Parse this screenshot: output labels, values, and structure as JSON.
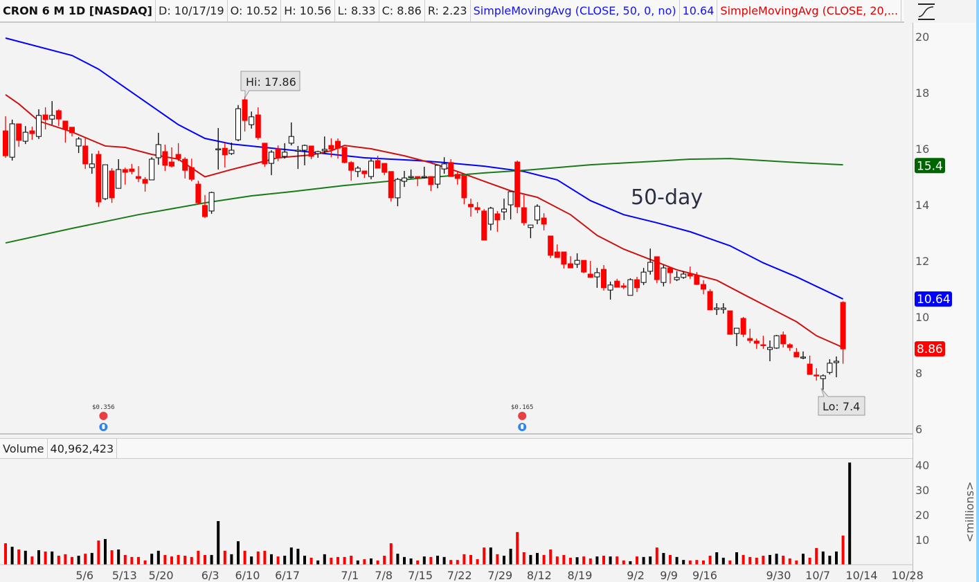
{
  "header": {
    "symbol": "CRON 6 M 1D [NASDAQ]",
    "date": "D: 10/17/19",
    "open": "O: 10.52",
    "high": "H: 10.56",
    "low": "L: 8.33",
    "close": "C: 8.86",
    "range": "R: 2.23",
    "sma50_label": "SimpleMovingAvg (CLOSE, 50, 0, no)",
    "sma50_value": "10.64",
    "sma20_label": "SimpleMovingAvg (CLOSE, 20,..."
  },
  "style_icon": "chart-style-icon",
  "volume_header": {
    "label": "Volume",
    "value": "40,962,423"
  },
  "annotations": {
    "hi": "Hi: 17.86",
    "lo": "Lo: 7.4",
    "text": "50-day"
  },
  "events": [
    {
      "label": "$0.356",
      "index": 14,
      "icons": [
        "earnings-icon",
        "dividend-icon"
      ]
    },
    {
      "label": "$0.165",
      "index": 77,
      "icons": [
        "earnings-icon",
        "dividend-icon"
      ]
    }
  ],
  "price_badges": [
    {
      "label": "15.4",
      "value": 15.4,
      "color": "#006400"
    },
    {
      "label": "10.64",
      "value": 10.64,
      "color": "#0000ff"
    },
    {
      "label": "8.86",
      "value": 8.86,
      "color": "#ff0000"
    }
  ],
  "colors": {
    "up": "#000000",
    "down": "#ff0000",
    "sma50": "#0000ff",
    "sma20": "#cc1111",
    "sma200": "#1a7a1a"
  },
  "chart_data": {
    "type": "candlestick",
    "title": "CRON 6 M 1D [NASDAQ]",
    "price_axis": {
      "ylim": [
        6,
        20
      ],
      "ticks": [
        "20",
        "18",
        "16",
        "14",
        "12",
        "10",
        "8",
        "6"
      ]
    },
    "volume_axis": {
      "ylim": [
        0,
        45
      ],
      "ticks": [
        "40",
        "30",
        "20",
        "10"
      ],
      "unit_label": "<millions>"
    },
    "x_ticks": [
      {
        "label": "5/6",
        "index": 11.9
      },
      {
        "label": "5/13",
        "index": 17.9
      },
      {
        "label": "5/20",
        "index": 23.4
      },
      {
        "label": "6/3",
        "index": 30.8
      },
      {
        "label": "6/10",
        "index": 36.4
      },
      {
        "label": "6/17",
        "index": 42.4
      },
      {
        "label": "7/1",
        "index": 51.8
      },
      {
        "label": "7/8",
        "index": 56.9
      },
      {
        "label": "7/15",
        "index": 62.4
      },
      {
        "label": "7/22",
        "index": 68.3
      },
      {
        "label": "7/29",
        "index": 74.4
      },
      {
        "label": "8/12",
        "index": 80.3
      },
      {
        "label": "8/19",
        "index": 86.4
      },
      {
        "label": "9/2",
        "index": 94.8
      },
      {
        "label": "9/9",
        "index": 99.8
      },
      {
        "label": "9/16",
        "index": 105.2
      },
      {
        "label": "9/30",
        "index": 116.3
      },
      {
        "label": "10/7",
        "index": 122.2
      },
      {
        "label": "10/14",
        "index": 128.8
      },
      {
        "label": "10/28",
        "index": 135.7
      }
    ],
    "ohlc": [
      [
        16.64,
        17.16,
        15.68,
        15.75
      ],
      [
        15.7,
        17.04,
        15.58,
        16.89
      ],
      [
        16.89,
        16.89,
        16.07,
        16.3
      ],
      [
        16.27,
        16.81,
        16.17,
        16.59
      ],
      [
        16.64,
        16.79,
        16.32,
        16.54
      ],
      [
        16.44,
        17.41,
        16.35,
        17.19
      ],
      [
        17.21,
        17.48,
        16.69,
        17.04
      ],
      [
        17.06,
        17.7,
        16.86,
        17.19
      ],
      [
        17.36,
        17.41,
        16.81,
        17.06
      ],
      [
        16.99,
        16.99,
        16.22,
        16.69
      ],
      [
        16.77,
        16.77,
        16.44,
        16.57
      ],
      [
        16.1,
        16.42,
        15.85,
        16.35
      ],
      [
        16.1,
        16.4,
        15.28,
        15.46
      ],
      [
        15.33,
        15.83,
        15.11,
        15.46
      ],
      [
        15.8,
        15.93,
        13.93,
        14.1
      ],
      [
        14.22,
        15.43,
        14.17,
        15.43
      ],
      [
        15.21,
        15.31,
        14.07,
        14.25
      ],
      [
        14.59,
        15.63,
        14.59,
        15.26
      ],
      [
        15.26,
        15.33,
        14.72,
        15.16
      ],
      [
        15.28,
        15.46,
        15.09,
        15.19
      ],
      [
        15.01,
        15.38,
        14.81,
        14.94
      ],
      [
        14.91,
        14.99,
        14.47,
        14.77
      ],
      [
        14.89,
        15.7,
        14.89,
        15.63
      ],
      [
        15.68,
        16.57,
        15.43,
        16.15
      ],
      [
        15.9,
        16.15,
        15.21,
        15.41
      ],
      [
        15.53,
        16.05,
        15.33,
        15.38
      ],
      [
        15.8,
        16.2,
        15.56,
        15.65
      ],
      [
        15.63,
        15.7,
        14.94,
        15.23
      ],
      [
        15.33,
        15.65,
        14.84,
        14.91
      ],
      [
        14.74,
        14.86,
        14.02,
        14.07
      ],
      [
        13.98,
        14.35,
        13.53,
        13.58
      ],
      [
        13.78,
        14.47,
        13.68,
        14.44
      ],
      [
        16.0,
        16.74,
        15.26,
        16.0
      ],
      [
        16.02,
        16.22,
        15.33,
        15.78
      ],
      [
        15.83,
        16.22,
        15.78,
        15.95
      ],
      [
        16.32,
        17.56,
        16.27,
        17.43
      ],
      [
        17.75,
        17.86,
        16.62,
        17.01
      ],
      [
        16.86,
        17.33,
        16.72,
        17.14
      ],
      [
        17.21,
        17.48,
        16.32,
        16.4
      ],
      [
        16.2,
        16.2,
        15.36,
        15.46
      ],
      [
        15.48,
        15.95,
        15.06,
        15.88
      ],
      [
        16.0,
        16.12,
        15.56,
        15.7
      ],
      [
        15.73,
        16.2,
        15.65,
        15.88
      ],
      [
        16.2,
        16.94,
        16.12,
        16.44
      ],
      [
        15.95,
        16.1,
        15.28,
        15.95
      ],
      [
        15.95,
        16.15,
        15.41,
        16.12
      ],
      [
        16.1,
        16.1,
        15.63,
        15.73
      ],
      [
        15.83,
        15.93,
        15.68,
        15.9
      ],
      [
        15.93,
        16.44,
        15.85,
        15.98
      ],
      [
        16.12,
        16.37,
        15.7,
        15.98
      ],
      [
        16.27,
        16.37,
        15.65,
        16.02
      ],
      [
        16.05,
        16.05,
        15.48,
        15.51
      ],
      [
        15.51,
        15.56,
        14.86,
        15.23
      ],
      [
        15.19,
        15.38,
        14.99,
        15.31
      ],
      [
        15.21,
        15.21,
        14.96,
        15.11
      ],
      [
        15.01,
        15.65,
        14.91,
        15.56
      ],
      [
        15.58,
        15.75,
        15.31,
        15.31
      ],
      [
        15.48,
        15.48,
        15.06,
        15.16
      ],
      [
        15.19,
        15.19,
        14.12,
        14.25
      ],
      [
        14.25,
        14.96,
        13.95,
        14.91
      ],
      [
        14.84,
        15.21,
        14.64,
        14.96
      ],
      [
        15.01,
        15.26,
        14.94,
        15.01
      ],
      [
        15.01,
        15.01,
        14.67,
        14.96
      ],
      [
        15.01,
        15.36,
        14.94,
        15.01
      ],
      [
        15.01,
        15.01,
        14.49,
        14.72
      ],
      [
        14.74,
        15.43,
        14.59,
        15.41
      ],
      [
        15.28,
        15.7,
        15.11,
        15.46
      ],
      [
        15.51,
        15.63,
        15.01,
        15.01
      ],
      [
        15.09,
        15.19,
        14.72,
        14.94
      ],
      [
        15.04,
        15.04,
        14.02,
        14.25
      ],
      [
        14.02,
        14.22,
        13.58,
        13.93
      ],
      [
        13.9,
        14.1,
        13.7,
        13.83
      ],
      [
        13.78,
        13.85,
        12.74,
        12.74
      ],
      [
        13.31,
        13.93,
        13.09,
        13.88
      ],
      [
        13.68,
        13.78,
        13.04,
        13.46
      ],
      [
        13.75,
        14.22,
        13.46,
        13.85
      ],
      [
        14.0,
        14.47,
        13.48,
        14.47
      ],
      [
        15.53,
        15.58,
        13.7,
        13.93
      ],
      [
        13.9,
        14.35,
        13.26,
        13.36
      ],
      [
        13.19,
        13.28,
        12.81,
        13.28
      ],
      [
        13.46,
        14.02,
        13.31,
        13.95
      ],
      [
        13.53,
        13.7,
        13.09,
        13.31
      ],
      [
        12.89,
        12.89,
        12.1,
        12.2
      ],
      [
        12.32,
        12.59,
        12.12,
        12.12
      ],
      [
        12.32,
        12.32,
        11.73,
        11.88
      ],
      [
        11.9,
        12.17,
        11.75,
        11.75
      ],
      [
        11.88,
        12.27,
        11.75,
        12.02
      ],
      [
        12.02,
        12.02,
        11.56,
        11.6
      ],
      [
        11.53,
        12.0,
        11.41,
        11.41
      ],
      [
        11.43,
        11.75,
        11.04,
        11.58
      ],
      [
        11.7,
        11.85,
        10.94,
        11.04
      ],
      [
        10.96,
        11.26,
        10.62,
        11.14
      ],
      [
        11.28,
        11.36,
        11.06,
        11.06
      ],
      [
        11.11,
        11.21,
        10.99,
        11.06
      ],
      [
        10.77,
        11.38,
        10.77,
        11.33
      ],
      [
        11.33,
        11.43,
        10.89,
        11.04
      ],
      [
        11.23,
        11.75,
        11.14,
        11.6
      ],
      [
        11.63,
        12.44,
        11.51,
        11.95
      ],
      [
        12.15,
        12.15,
        11.21,
        11.33
      ],
      [
        11.23,
        11.85,
        11.09,
        11.75
      ],
      [
        11.75,
        11.78,
        11.19,
        11.58
      ],
      [
        11.33,
        11.63,
        11.28,
        11.41
      ],
      [
        11.41,
        11.63,
        11.36,
        11.53
      ],
      [
        11.53,
        11.8,
        11.36,
        11.46
      ],
      [
        11.48,
        11.6,
        11.14,
        11.16
      ],
      [
        11.16,
        11.31,
        10.81,
        10.99
      ],
      [
        10.91,
        10.99,
        10.25,
        10.25
      ],
      [
        10.27,
        10.49,
        10.07,
        10.32
      ],
      [
        10.27,
        10.49,
        10.12,
        10.32
      ],
      [
        10.22,
        10.22,
        9.38,
        9.38
      ],
      [
        9.41,
        9.6,
        8.96,
        9.6
      ],
      [
        9.95,
        10.0,
        9.28,
        9.38
      ],
      [
        9.23,
        9.58,
        9.06,
        9.16
      ],
      [
        9.14,
        9.23,
        8.86,
        9.06
      ],
      [
        9.01,
        9.33,
        8.86,
        8.99
      ],
      [
        8.84,
        9.16,
        8.42,
        8.91
      ],
      [
        8.89,
        9.36,
        8.86,
        9.33
      ],
      [
        9.36,
        9.48,
        8.91,
        9.04
      ],
      [
        9.01,
        9.06,
        8.79,
        8.91
      ],
      [
        8.74,
        8.89,
        8.57,
        8.57
      ],
      [
        8.57,
        8.77,
        8.49,
        8.57
      ],
      [
        8.32,
        8.62,
        7.93,
        7.95
      ],
      [
        7.93,
        8.17,
        7.73,
        7.9
      ],
      [
        7.8,
        7.95,
        7.4,
        7.9
      ],
      [
        8.02,
        8.49,
        7.95,
        8.35
      ],
      [
        8.37,
        8.59,
        7.85,
        8.42
      ],
      [
        10.52,
        10.56,
        8.33,
        8.86
      ]
    ],
    "volume_millions": [
      8.6,
      7.2,
      6.1,
      5.6,
      3.3,
      5.8,
      5.3,
      5.3,
      3.6,
      4.2,
      3.1,
      3.6,
      4.4,
      4.7,
      9.7,
      10.3,
      5.8,
      6.1,
      3.9,
      3.1,
      3.1,
      1.7,
      4.4,
      5.6,
      3.9,
      3.3,
      3.9,
      3.6,
      3.1,
      5.6,
      3.9,
      3.9,
      17.5,
      5.6,
      4.2,
      9.4,
      5.6,
      3.3,
      5.3,
      5.6,
      4.2,
      3.3,
      3.6,
      6.9,
      6.4,
      3.6,
      2.8,
      1.7,
      4.2,
      2.8,
      3.1,
      3.1,
      3.6,
      1.7,
      2.2,
      2.5,
      1.7,
      3.6,
      8.6,
      4.4,
      3.1,
      2.5,
      1.7,
      3.3,
      3.1,
      3.6,
      3.1,
      1.9,
      1.9,
      4.2,
      3.9,
      2.2,
      6.9,
      6.9,
      4.2,
      3.6,
      6.4,
      13.1,
      5.0,
      3.9,
      4.7,
      3.9,
      6.1,
      3.3,
      3.9,
      2.8,
      3.0,
      3.3,
      2.5,
      3.3,
      3.6,
      3.3,
      3.3,
      1.7,
      1.4,
      3.3,
      3.1,
      3.3,
      6.9,
      4.7,
      3.9,
      3.1,
      1.9,
      1.7,
      1.9,
      1.7,
      3.6,
      5.0,
      2.8,
      1.7,
      5.0,
      3.9,
      3.1,
      2.8,
      3.6,
      3.9,
      4.4,
      3.6,
      2.5,
      1.7,
      4.4,
      2.8,
      6.7,
      5.3,
      3.6,
      5.3,
      11.7,
      41.0
    ],
    "series": [
      {
        "name": "SMA 50",
        "points": [
          [
            0,
            19.95
          ],
          [
            10,
            19.33
          ],
          [
            14,
            18.84
          ],
          [
            20,
            17.85
          ],
          [
            26,
            16.86
          ],
          [
            30,
            16.37
          ],
          [
            34,
            16.17
          ],
          [
            41,
            16.0
          ],
          [
            48,
            15.83
          ],
          [
            54,
            15.68
          ],
          [
            62,
            15.58
          ],
          [
            66,
            15.51
          ],
          [
            72,
            15.38
          ],
          [
            78,
            15.19
          ],
          [
            83,
            14.89
          ],
          [
            88,
            14.15
          ],
          [
            93,
            13.65
          ],
          [
            98,
            13.36
          ],
          [
            103,
            13.04
          ],
          [
            109,
            12.54
          ],
          [
            114,
            11.93
          ],
          [
            119,
            11.43
          ],
          [
            126,
            10.64
          ]
        ]
      },
      {
        "name": "SMA 20",
        "points": [
          [
            0,
            17.93
          ],
          [
            2,
            17.6
          ],
          [
            5,
            16.99
          ],
          [
            10,
            16.6
          ],
          [
            15,
            16.1
          ],
          [
            18,
            16.05
          ],
          [
            22,
            15.8
          ],
          [
            26,
            15.63
          ],
          [
            30,
            15.0
          ],
          [
            34,
            15.26
          ],
          [
            38,
            15.5
          ],
          [
            41,
            15.68
          ],
          [
            46,
            15.78
          ],
          [
            49,
            15.93
          ],
          [
            51,
            16.12
          ],
          [
            55,
            16.0
          ],
          [
            60,
            15.75
          ],
          [
            64,
            15.5
          ],
          [
            68,
            15.19
          ],
          [
            72,
            14.84
          ],
          [
            76,
            14.5
          ],
          [
            80,
            14.27
          ],
          [
            85,
            13.65
          ],
          [
            89,
            12.91
          ],
          [
            93,
            12.42
          ],
          [
            97,
            12.05
          ],
          [
            101,
            11.68
          ],
          [
            107,
            11.31
          ],
          [
            111,
            10.81
          ],
          [
            115,
            10.32
          ],
          [
            119,
            9.83
          ],
          [
            122,
            9.33
          ],
          [
            126,
            8.91
          ]
        ]
      },
      {
        "name": "SMA 200",
        "points": [
          [
            0,
            12.64
          ],
          [
            10,
            13.16
          ],
          [
            20,
            13.65
          ],
          [
            30,
            14.07
          ],
          [
            37,
            14.32
          ],
          [
            43,
            14.47
          ],
          [
            51,
            14.69
          ],
          [
            62,
            14.94
          ],
          [
            72,
            15.14
          ],
          [
            78,
            15.23
          ],
          [
            88,
            15.43
          ],
          [
            98,
            15.56
          ],
          [
            103,
            15.63
          ],
          [
            109,
            15.65
          ],
          [
            114,
            15.58
          ],
          [
            119,
            15.51
          ],
          [
            126,
            15.43
          ]
        ]
      }
    ]
  }
}
